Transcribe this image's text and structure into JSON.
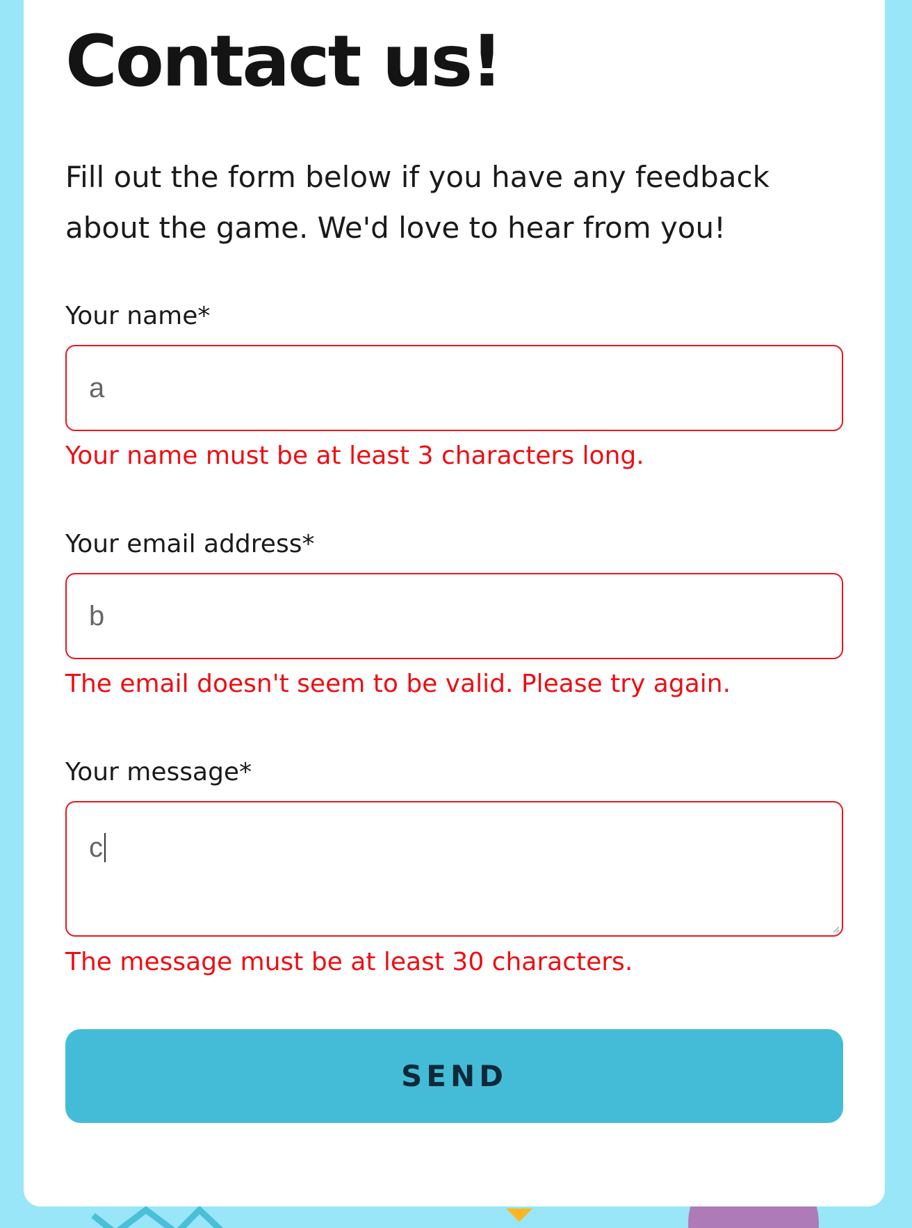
{
  "page": {
    "title": "Contact us!",
    "intro": "Fill out the form below if you have any feedback about the game. We'd love to hear from you!"
  },
  "form": {
    "name": {
      "label": "Your name*",
      "value": "a",
      "error": "Your name must be at least 3 characters long."
    },
    "email": {
      "label": "Your email address*",
      "value": "b",
      "error": "The email doesn't seem to be valid. Please try again."
    },
    "message": {
      "label": "Your message*",
      "value": "c",
      "error": "The message must be at least 30 characters."
    },
    "submit_label": "SEND"
  },
  "colors": {
    "background": "#98e6f8",
    "card": "#ffffff",
    "error": "#ee0d12",
    "button": "#45bcd7",
    "button_text": "#0e2a3a"
  }
}
